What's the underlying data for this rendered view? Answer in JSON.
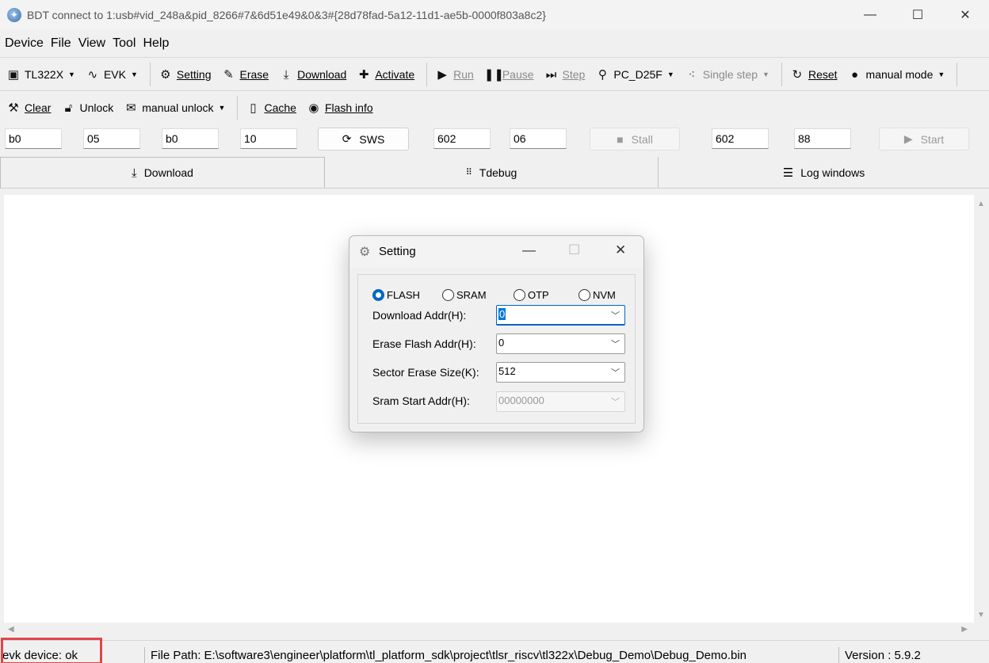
{
  "window": {
    "title": "BDT connect to 1:usb#vid_248a&pid_8266#7&6d51e49&0&3#{28d78fad-5a12-11d1-ae5b-0000f803a8c2}",
    "minimize": "—",
    "maximize": "☐",
    "close": "✕"
  },
  "menu": [
    "Device",
    "File",
    "View",
    "Tool",
    "Help"
  ],
  "toolbar1": {
    "chip": "TL322X",
    "evk": "EVK",
    "setting": "Setting",
    "erase": "Erase",
    "download": "Download",
    "activate": "Activate",
    "run": "Run",
    "pause": "Pause",
    "step": "Step",
    "pc": "PC_D25F",
    "single_step": "Single step",
    "reset": "Reset",
    "mode": "manual mode"
  },
  "toolbar2": {
    "clear": "Clear",
    "unlock": "Unlock",
    "manual_unlock": "manual unlock",
    "cache": "Cache",
    "flash_info": "Flash info"
  },
  "registers": {
    "r1": "b0",
    "r2": "05",
    "r3": "b0",
    "r4": "10",
    "sws": "SWS",
    "r5": "602",
    "r6": "06",
    "stall": "Stall",
    "r7": "602",
    "r8": "88",
    "start": "Start"
  },
  "tabs": {
    "download": "Download",
    "tdebug": "Tdebug",
    "log": "Log windows"
  },
  "status": {
    "device": "evk device: ok",
    "file_path": "File Path:  E:\\software3\\engineer\\platform\\tl_platform_sdk\\project\\tlsr_riscv\\tl322x\\Debug_Demo\\Debug_Demo.bin",
    "version": "Version : 5.9.2"
  },
  "dialog": {
    "title": "Setting",
    "radios": {
      "flash": "FLASH",
      "sram": "SRAM",
      "otp": "OTP",
      "nvm": "NVM",
      "selected": "FLASH"
    },
    "download_addr_label": "Download  Addr(H):",
    "download_addr_value": "0",
    "erase_addr_label": "Erase Flash Addr(H):",
    "erase_addr_value": "0",
    "sector_size_label": "Sector Erase Size(K):",
    "sector_size_value": "512",
    "sram_addr_label": "Sram Start Addr(H):",
    "sram_addr_value": "00000000"
  },
  "colors": {
    "accent": "#0067c0",
    "highlight": "#e0464a"
  }
}
